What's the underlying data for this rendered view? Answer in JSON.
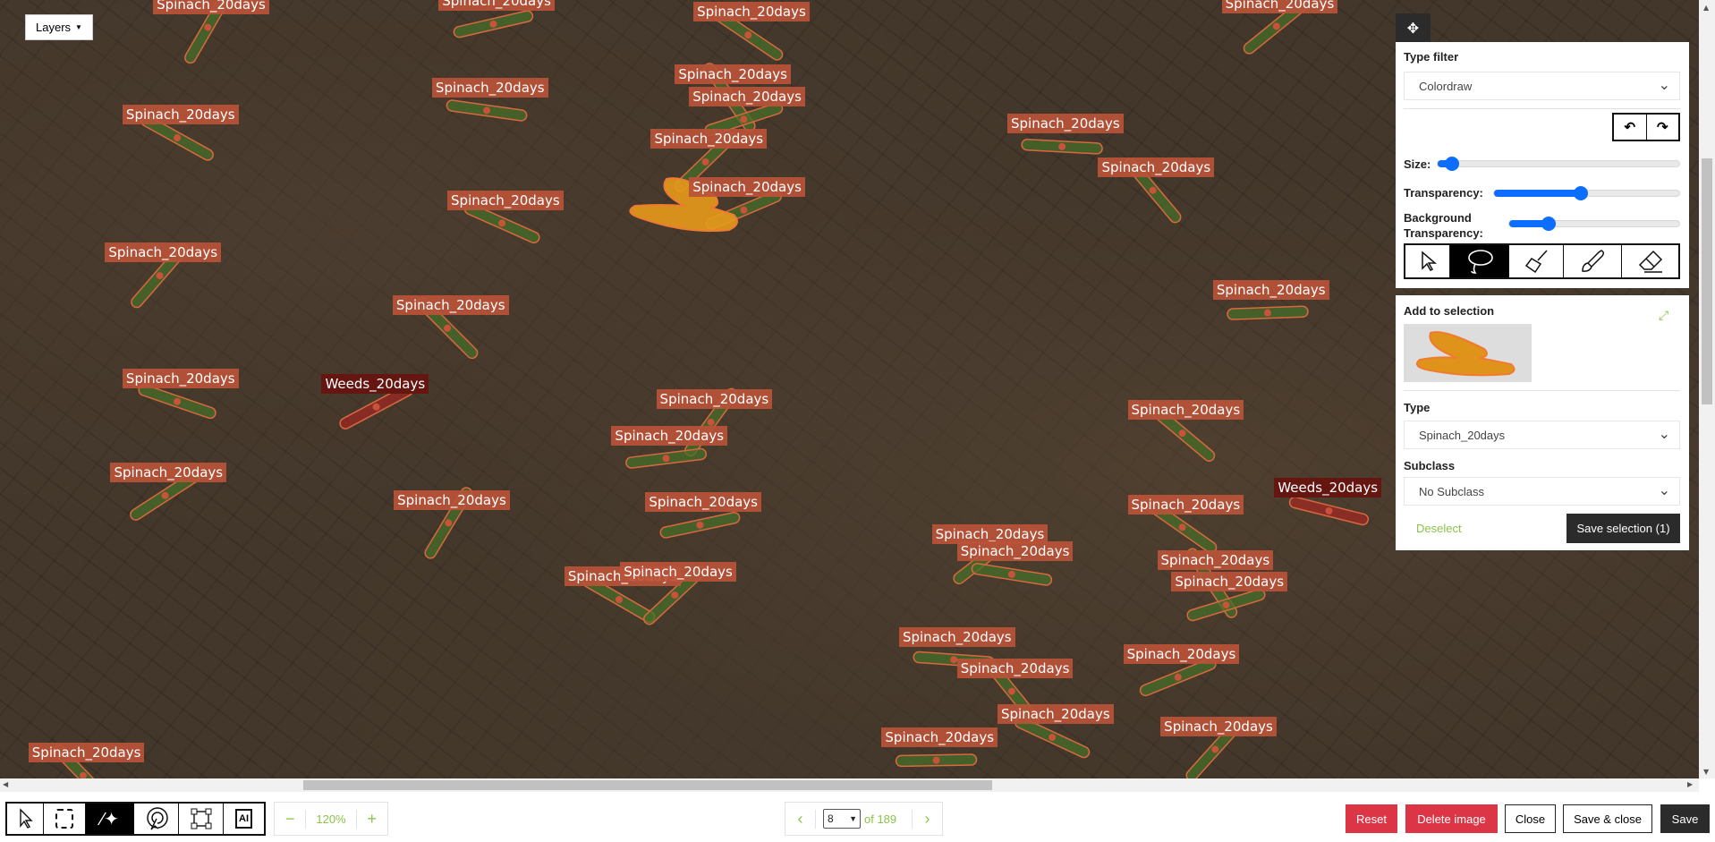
{
  "layers_button": {
    "label": "Layers"
  },
  "annotations": [
    "Spinach_20days",
    "Spinach_20days",
    "Spinach_20days",
    "Spinach_20days",
    "Spinach_20days",
    "Spinach_20days",
    "Spinach_20days",
    "Spinach_20days",
    "Spinach_20days",
    "Spinach_20days",
    "Spinach_20days",
    "Spinach_20days",
    "Spinach_20days",
    "Spinach_20days",
    "Spinach_20days",
    "Spinach_20days",
    "Weeds_20days",
    "Spinach_20days",
    "Spinach_20days",
    "Spinach_20days",
    "Spinach_20days",
    "Spinach_20days",
    "Weeds_20days",
    "Spinach_20days",
    "Spinach_20days",
    "Spinach_20days",
    "Spinach_20days",
    "Spinach_20days",
    "Spinach_20days",
    "Spinach_20days",
    "Spinach_20days",
    "Spinach_20days",
    "Spinach_20days",
    "Spinach_20days",
    "Spinach_20days",
    "Spinach_20days",
    "Spinach_20days",
    "Spinach_20days",
    "Spinach_20days"
  ],
  "colors": {
    "spinach_label": "#ba5238",
    "weeds_label": "#651611",
    "selection": "#e89a1c",
    "accent": "#0d6efd",
    "green": "#8bc34a",
    "danger": "#dc3545",
    "dark": "#2b2b2b"
  },
  "tool_panel": {
    "type_filter_label": "Type filter",
    "type_filter_value": "Colordraw",
    "undo_icon": "undo-icon",
    "redo_icon": "redo-icon",
    "size_label": "Size:",
    "size_value": 6,
    "transparency_label": "Transparency:",
    "transparency_value": 47,
    "background_transparency_label": "Background Transparency:",
    "background_transparency_value": 23,
    "tools": [
      "pointer",
      "lasso",
      "broom",
      "brush",
      "eraser"
    ],
    "active_tool": "lasso"
  },
  "selection_panel": {
    "title": "Add to selection",
    "type_label": "Type",
    "type_value": "Spinach_20days",
    "subclass_label": "Subclass",
    "subclass_value": "No Subclass",
    "deselect_label": "Deselect",
    "save_selection_label": "Save selection (1)"
  },
  "bottom_toolbar": {
    "tools": [
      "pointer",
      "rect-select",
      "magic-wand",
      "auto-select",
      "polygon",
      "ai"
    ],
    "active_tool": "magic-wand",
    "zoom": "120%",
    "zoom_out": "−",
    "zoom_in": "+",
    "page_current": "8",
    "page_total": "of 189"
  },
  "actions": {
    "reset": "Reset",
    "delete_image": "Delete image",
    "close": "Close",
    "save_close": "Save & close",
    "save": "Save"
  }
}
